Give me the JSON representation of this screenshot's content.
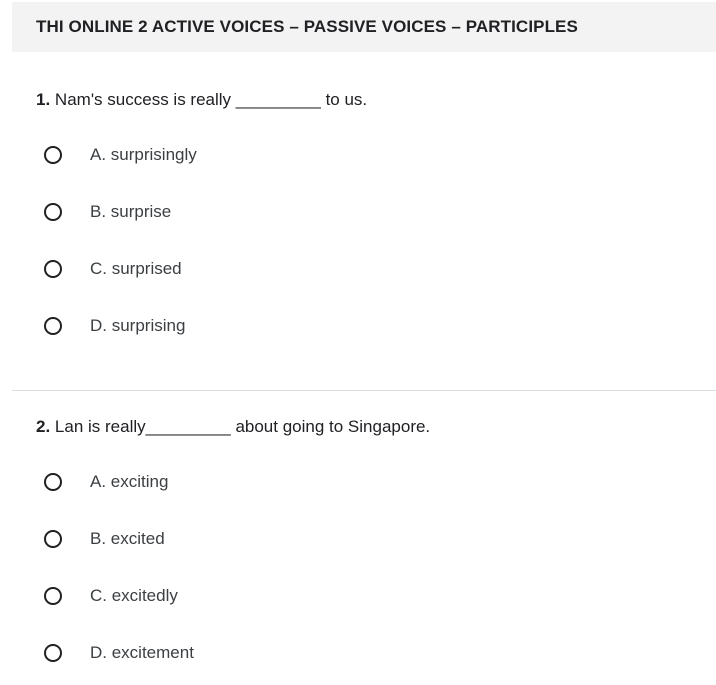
{
  "header": {
    "title": "THI ONLINE 2 ACTIVE VOICES – PASSIVE VOICES – PARTICIPLES"
  },
  "questions": [
    {
      "number": "1.",
      "text": "Nam's success is really _________ to us.",
      "options": [
        "A. surprisingly",
        "B. surprise",
        "C. surprised",
        "D. surprising"
      ]
    },
    {
      "number": "2.",
      "text": "Lan is really_________ about going to Singapore.",
      "options": [
        "A. exciting",
        "B. excited",
        "C. excitedly",
        "D. excitement"
      ]
    }
  ],
  "icons": {
    "radio": "radio-unchecked-icon"
  }
}
